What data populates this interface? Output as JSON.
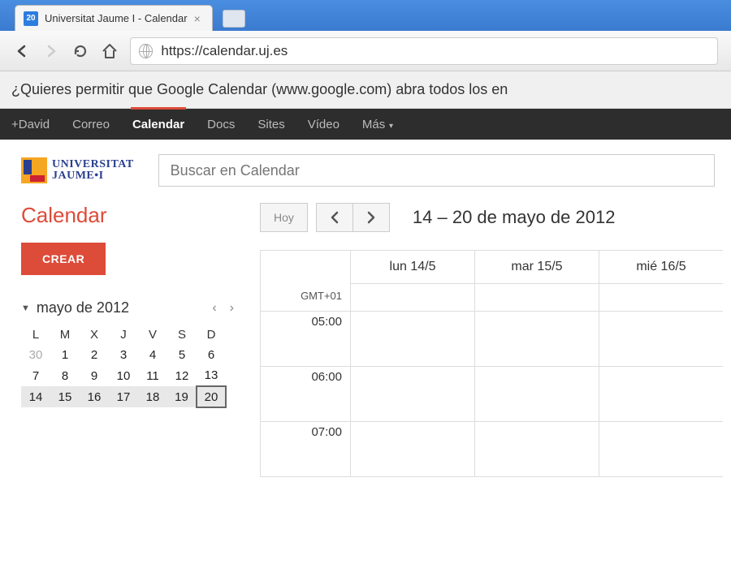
{
  "browser": {
    "tab_title": "Universitat Jaume I - Calendar",
    "tab_favicon_text": "20",
    "url": "https://calendar.uj.es"
  },
  "info_bar_text": "¿Quieres permitir que Google Calendar (www.google.com) abra todos los en",
  "gbar": {
    "items": [
      "+David",
      "Correo",
      "Calendar",
      "Docs",
      "Sites",
      "Vídeo",
      "Más"
    ],
    "active_index": 2
  },
  "logo": {
    "line1": "UNIVERSITAT",
    "line2": "JAUME•I"
  },
  "search_placeholder": "Buscar en Calendar",
  "sidebar": {
    "title": "Calendar",
    "create_label": "CREAR",
    "mini_cal": {
      "month_label": "mayo de 2012",
      "dow": [
        "L",
        "M",
        "X",
        "J",
        "V",
        "S",
        "D"
      ],
      "weeks": [
        [
          {
            "d": "30",
            "other": true
          },
          {
            "d": "1"
          },
          {
            "d": "2"
          },
          {
            "d": "3"
          },
          {
            "d": "4"
          },
          {
            "d": "5"
          },
          {
            "d": "6"
          }
        ],
        [
          {
            "d": "7"
          },
          {
            "d": "8"
          },
          {
            "d": "9"
          },
          {
            "d": "10"
          },
          {
            "d": "11"
          },
          {
            "d": "12"
          },
          {
            "d": "13"
          }
        ],
        [
          {
            "d": "14"
          },
          {
            "d": "15"
          },
          {
            "d": "16"
          },
          {
            "d": "17"
          },
          {
            "d": "18"
          },
          {
            "d": "19"
          },
          {
            "d": "20",
            "today": true
          }
        ]
      ],
      "current_week_index": 2
    }
  },
  "controls": {
    "today_label": "Hoy",
    "date_range": "14 – 20 de mayo de 2012"
  },
  "grid": {
    "timezone": "GMT+01",
    "day_headers": [
      "lun 14/5",
      "mar 15/5",
      "mié 16/5"
    ],
    "hours": [
      "05:00",
      "06:00",
      "07:00"
    ]
  }
}
